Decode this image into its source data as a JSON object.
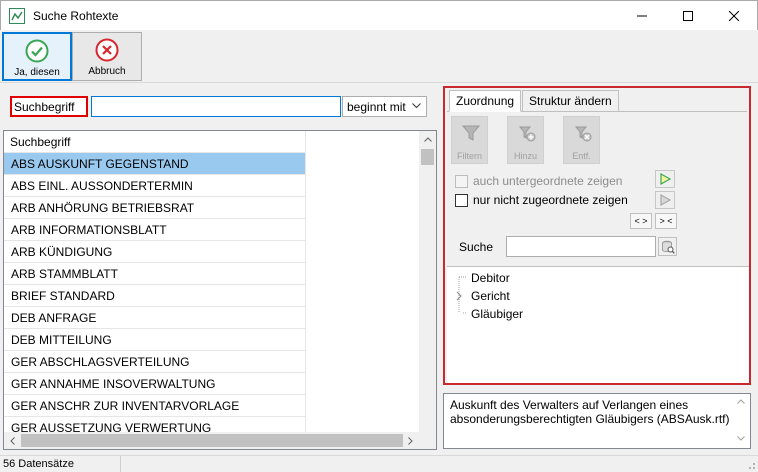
{
  "window": {
    "title": "Suche Rohtexte"
  },
  "toolbar": {
    "ok_label": "Ja, diesen",
    "cancel_label": "Abbruch",
    "ok_color": "#3aa655",
    "cancel_color": "#d9262e"
  },
  "search": {
    "label": "Suchbegriff",
    "value": "",
    "mode": "beginnt mit"
  },
  "list": {
    "header": "Suchbegriff",
    "items": [
      "ABS AUSKUNFT GEGENSTAND",
      "ABS EINL. AUSSONDERTERMIN",
      "ARB ANHÖRUNG BETRIEBSRAT",
      "ARB INFORMATIONSBLATT",
      "ARB KÜNDIGUNG",
      "ARB STAMMBLATT",
      "BRIEF STANDARD",
      "DEB ANFRAGE",
      "DEB MITTEILUNG",
      "GER ABSCHLAGSVERTEILUNG",
      "GER ANNAHME INSOVERWALTUNG",
      "GER ANSCHR ZUR INVENTARVORLAGE",
      "GER AUSSETZUNG VERWERTUNG"
    ],
    "selected_index": 0
  },
  "panel": {
    "tabs": [
      "Zuordnung",
      "Struktur ändern"
    ],
    "active_tab": 0,
    "tools": [
      "Filtern",
      "Hinzu",
      "Entf."
    ],
    "check_sub": "auch untergeordnete zeigen",
    "check_unassigned": "nur nicht zugeordnete zeigen",
    "btn_expand": "< >",
    "btn_collapse": "> <",
    "search_label": "Suche",
    "search_value": "",
    "tree": [
      "Debitor",
      "Gericht",
      "Gläubiger"
    ],
    "border_color": "#c8282e"
  },
  "description": {
    "text": "Auskunft des Verwalters auf Verlangen eines absonderungsberechtigten Gläubigers (ABSAusk.rtf)"
  },
  "status": {
    "count_text": "56 Datensätze"
  }
}
